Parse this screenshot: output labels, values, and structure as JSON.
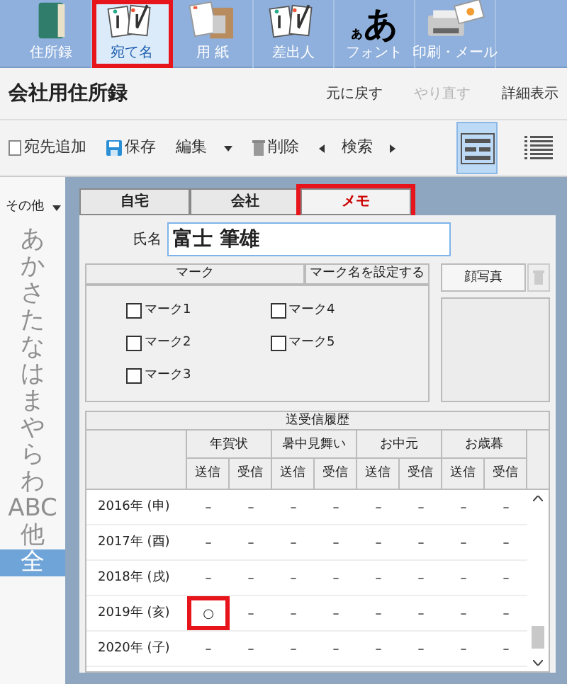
{
  "ribbon": [
    {
      "label": "住所録",
      "kind": "book",
      "selected": false,
      "highlighted": false
    },
    {
      "label": "宛て名",
      "kind": "cards",
      "selected": true,
      "highlighted": true
    },
    {
      "label": "用 紙",
      "kind": "paper",
      "selected": false,
      "highlighted": false
    },
    {
      "label": "差出人",
      "kind": "cards",
      "selected": false,
      "highlighted": false
    },
    {
      "label": "フォント",
      "kind": "font",
      "selected": false,
      "highlighted": false
    },
    {
      "label": "印刷・メール",
      "kind": "printer",
      "selected": false,
      "highlighted": false
    }
  ],
  "font_icon": {
    "small": "ぁ",
    "large": "あ"
  },
  "title": "会社用住所録",
  "title_actions": [
    {
      "label": "元に戻す",
      "disabled": false
    },
    {
      "label": "やり直す",
      "disabled": true
    },
    {
      "label": "詳細表示",
      "disabled": false
    }
  ],
  "toolbar": [
    {
      "label": "宛先追加",
      "kind": "page"
    },
    {
      "label": "保存",
      "kind": "save"
    },
    {
      "label": "編集",
      "kind": "menu"
    },
    {
      "label": "削除",
      "kind": "trash"
    },
    {
      "label": "検索",
      "kind": "nav"
    }
  ],
  "view_buttons": [
    {
      "kind": "card",
      "selected": true
    },
    {
      "kind": "list",
      "selected": false
    }
  ],
  "sidebar": {
    "filter": "その他",
    "items": [
      {
        "label": "あ",
        "selected": false
      },
      {
        "label": "か",
        "selected": false
      },
      {
        "label": "さ",
        "selected": false
      },
      {
        "label": "た",
        "selected": false
      },
      {
        "label": "な",
        "selected": false
      },
      {
        "label": "は",
        "selected": false
      },
      {
        "label": "ま",
        "selected": false
      },
      {
        "label": "や",
        "selected": false
      },
      {
        "label": "ら",
        "selected": false
      },
      {
        "label": "わ",
        "selected": false
      },
      {
        "label": "ABC",
        "selected": false
      },
      {
        "label": "他",
        "selected": false
      },
      {
        "label": "全",
        "selected": true
      }
    ]
  },
  "tabs": [
    {
      "label": "自宅",
      "selected": false,
      "highlighted": false
    },
    {
      "label": "会社",
      "selected": false,
      "highlighted": false
    },
    {
      "label": "メモ",
      "selected": true,
      "highlighted": true
    }
  ],
  "name": {
    "label": "氏名",
    "value": "富士 筆雄"
  },
  "marks": {
    "header": "マーク",
    "settings": "マーク名を設定する",
    "items": [
      {
        "label": "マーク1",
        "checked": false
      },
      {
        "label": "マーク2",
        "checked": false
      },
      {
        "label": "マーク3",
        "checked": false
      },
      {
        "label": "マーク4",
        "checked": false
      },
      {
        "label": "マーク5",
        "checked": false
      }
    ]
  },
  "photo": {
    "label": "顔写真"
  },
  "history": {
    "title": "送受信履歴",
    "groups": [
      {
        "label": "年賀状",
        "subcolumns": [
          "送信",
          "受信"
        ]
      },
      {
        "label": "暑中見舞い",
        "subcolumns": [
          "送信",
          "受信"
        ]
      },
      {
        "label": "お中元",
        "subcolumns": [
          "送信",
          "受信"
        ]
      },
      {
        "label": "お歳暮",
        "subcolumns": [
          "送信",
          "受信"
        ]
      }
    ],
    "rows": [
      {
        "year": "2016年 (申)",
        "cells": [
          "–",
          "–",
          "–",
          "–",
          "–",
          "–",
          "–",
          "–"
        ],
        "highlighted": [
          false,
          false,
          false,
          false,
          false,
          false,
          false,
          false
        ]
      },
      {
        "year": "2017年 (酉)",
        "cells": [
          "–",
          "–",
          "–",
          "–",
          "–",
          "–",
          "–",
          "–"
        ],
        "highlighted": [
          false,
          false,
          false,
          false,
          false,
          false,
          false,
          false
        ]
      },
      {
        "year": "2018年 (戌)",
        "cells": [
          "–",
          "–",
          "–",
          "–",
          "–",
          "–",
          "–",
          "–"
        ],
        "highlighted": [
          false,
          false,
          false,
          false,
          false,
          false,
          false,
          false
        ]
      },
      {
        "year": "2019年 (亥)",
        "cells": [
          "○",
          "–",
          "–",
          "–",
          "–",
          "–",
          "–",
          "–"
        ],
        "highlighted": [
          true,
          false,
          false,
          false,
          false,
          false,
          false,
          false
        ]
      },
      {
        "year": "2020年 (子)",
        "cells": [
          "–",
          "–",
          "–",
          "–",
          "–",
          "–",
          "–",
          "–"
        ],
        "highlighted": [
          false,
          false,
          false,
          false,
          false,
          false,
          false,
          false
        ]
      }
    ]
  }
}
